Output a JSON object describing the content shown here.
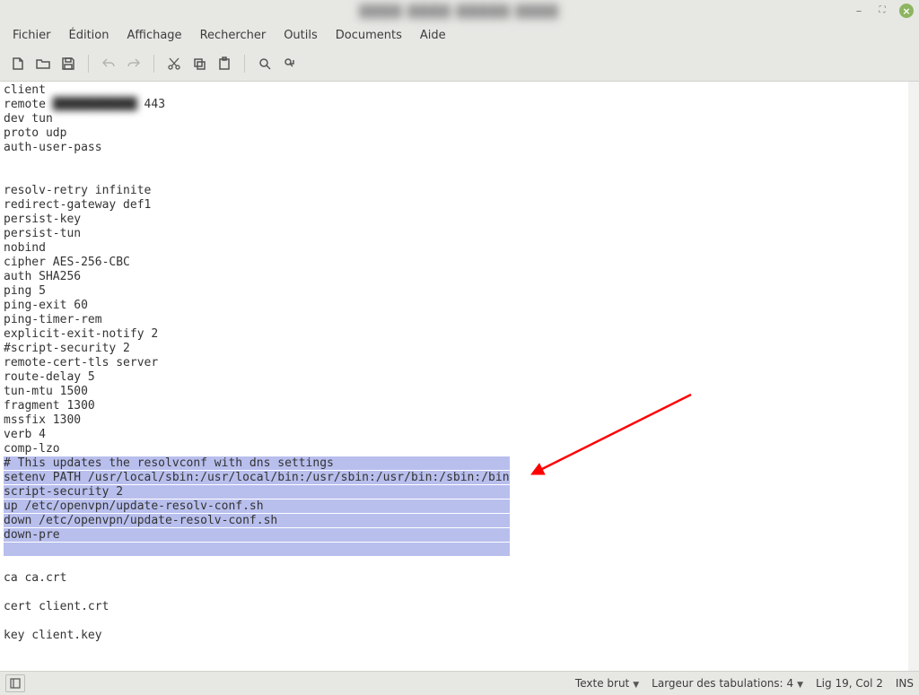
{
  "title": "",
  "menus": {
    "file": "Fichier",
    "edit": "Édition",
    "view": "Affichage",
    "search": "Rechercher",
    "tools": "Outils",
    "documents": "Documents",
    "help": "Aide"
  },
  "editor": {
    "before": [
      "client",
      "remote            443",
      "dev tun",
      "proto udp",
      "auth-user-pass",
      "",
      "",
      "resolv-retry infinite",
      "redirect-gateway def1",
      "persist-key",
      "persist-tun",
      "nobind",
      "cipher AES-256-CBC",
      "auth SHA256",
      "ping 5",
      "ping-exit 60",
      "ping-timer-rem",
      "explicit-exit-notify 2",
      "#script-security 2",
      "remote-cert-tls server",
      "route-delay 5",
      "tun-mtu 1500",
      "fragment 1300",
      "mssfix 1300",
      "verb 4",
      "comp-lzo"
    ],
    "selected": [
      "# This updates the resolvconf with dns settings",
      "setenv PATH /usr/local/sbin:/usr/local/bin:/usr/sbin:/usr/bin:/sbin:/bin",
      "script-security 2",
      "up /etc/openvpn/update-resolv-conf.sh",
      "down /etc/openvpn/update-resolv-conf.sh",
      "down-pre",
      ""
    ],
    "after": [
      "",
      "ca ca.crt",
      "",
      "cert client.crt",
      "",
      "key client.key",
      ""
    ],
    "remote_blur_placeholder": "            "
  },
  "status": {
    "syntax": "Texte brut",
    "tabwidth_label": "Largeur des tabulations:",
    "tabwidth_value": "4",
    "position": "Lig 19, Col 2",
    "mode": "INS"
  }
}
